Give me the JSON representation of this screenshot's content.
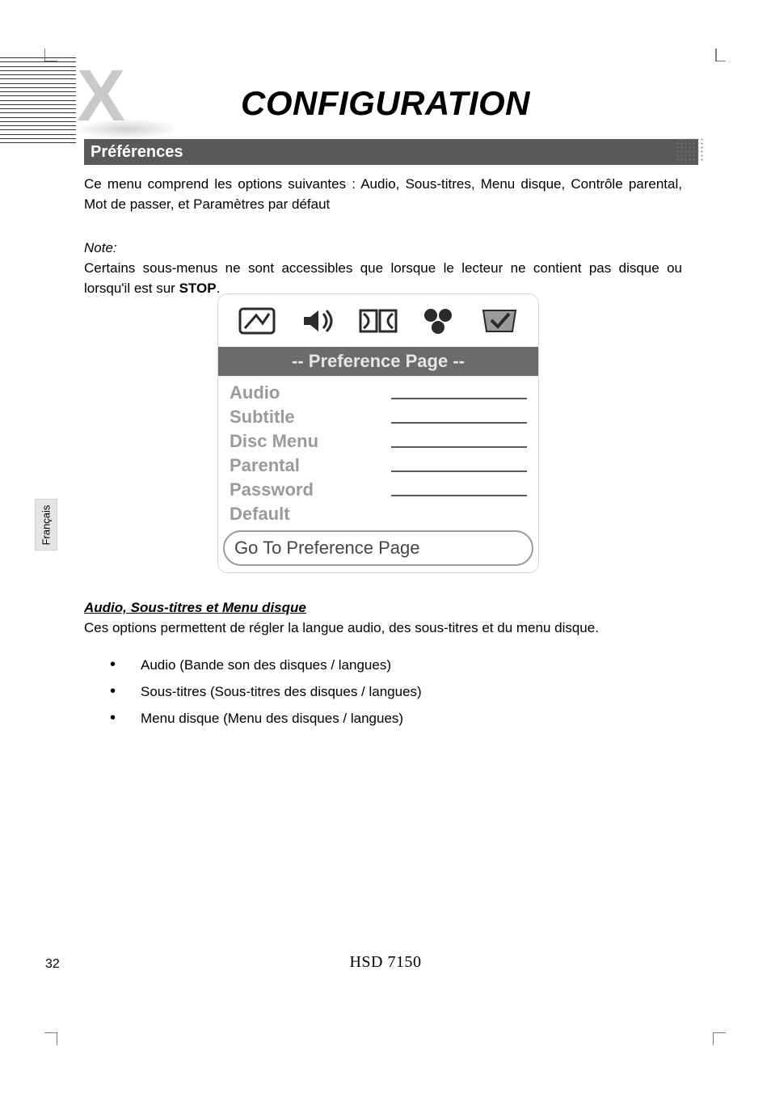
{
  "header": {
    "title": "CONFIGURATION",
    "section": "Préférences"
  },
  "intro": {
    "paragraph": "Ce menu comprend les options suivantes : Audio, Sous-titres, Menu disque, Contrôle parental, Mot de passer, et Paramètres par défaut",
    "note_label": "Note:",
    "note_text_before": "Certains sous-menus ne sont accessibles que lorsque le lecteur ne contient pas disque ou lorsqu'il est sur ",
    "note_bold": "STOP",
    "note_text_after": "."
  },
  "osd": {
    "page_title": "-- Preference Page --",
    "items": [
      "Audio",
      "Subtitle",
      "Disc Menu",
      "Parental",
      "Password",
      "Default"
    ],
    "goto": "Go To Preference Page",
    "icons": [
      "display-icon",
      "speaker-icon",
      "dolby-icon",
      "video-icon",
      "check-icon"
    ]
  },
  "subsection": {
    "title": "Audio, Sous-titres et Menu disque",
    "desc": "Ces options permettent de régler la langue audio, des sous-titres et du menu disque.",
    "bullets": [
      "Audio (Bande son des disques / langues)",
      "Sous-titres (Sous-titres des disques / langues)",
      "Menu disque (Menu des disques / langues)"
    ]
  },
  "sidebar": {
    "language": "Français"
  },
  "footer": {
    "page_number": "32",
    "model": "HЅD 7150"
  }
}
